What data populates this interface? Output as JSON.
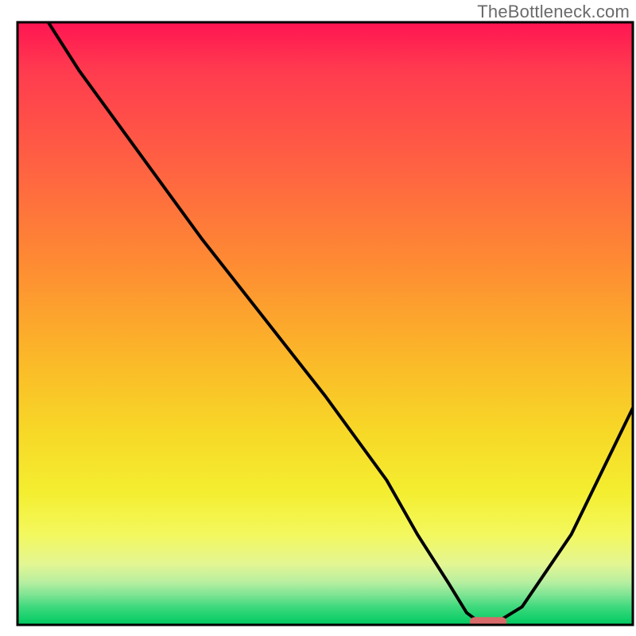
{
  "watermark": "TheBottleneck.com",
  "chart_data": {
    "type": "line",
    "title": "",
    "xlabel": "",
    "ylabel": "",
    "xlim": [
      0,
      100
    ],
    "ylim": [
      0,
      100
    ],
    "grid": false,
    "legend": false,
    "axes_visible": false,
    "background_gradient": {
      "direction": "vertical",
      "stops": [
        {
          "color": "#ff1552",
          "y": 0
        },
        {
          "color": "#ff3b4f",
          "y": 8
        },
        {
          "color": "#ff6242",
          "y": 24
        },
        {
          "color": "#fe8b33",
          "y": 40
        },
        {
          "color": "#fbb629",
          "y": 55
        },
        {
          "color": "#f7d827",
          "y": 68
        },
        {
          "color": "#f4ee30",
          "y": 78
        },
        {
          "color": "#f3f85e",
          "y": 85
        },
        {
          "color": "#e3f694",
          "y": 90
        },
        {
          "color": "#b6eea0",
          "y": 93
        },
        {
          "color": "#7ee494",
          "y": 95
        },
        {
          "color": "#3fd97d",
          "y": 97
        },
        {
          "color": "#13cf6a",
          "y": 99
        },
        {
          "color": "#00c95f",
          "y": 100
        }
      ]
    },
    "series": [
      {
        "name": "bottleneck-curve",
        "color": "#000000",
        "x": [
          5,
          10,
          15,
          20,
          30,
          40,
          50,
          60,
          65,
          70,
          73,
          75,
          78,
          82,
          90,
          100
        ],
        "y": [
          100,
          92,
          85,
          78,
          64,
          51,
          38,
          24,
          15,
          7,
          2,
          0.5,
          0.5,
          3,
          15,
          36
        ]
      }
    ],
    "marker": {
      "name": "optimal-marker",
      "x_center": 76.5,
      "y": 0.5,
      "width": 6,
      "color": "#d96a6a"
    },
    "plot_frame": {
      "color": "#000000",
      "stroke_width": 3
    }
  }
}
